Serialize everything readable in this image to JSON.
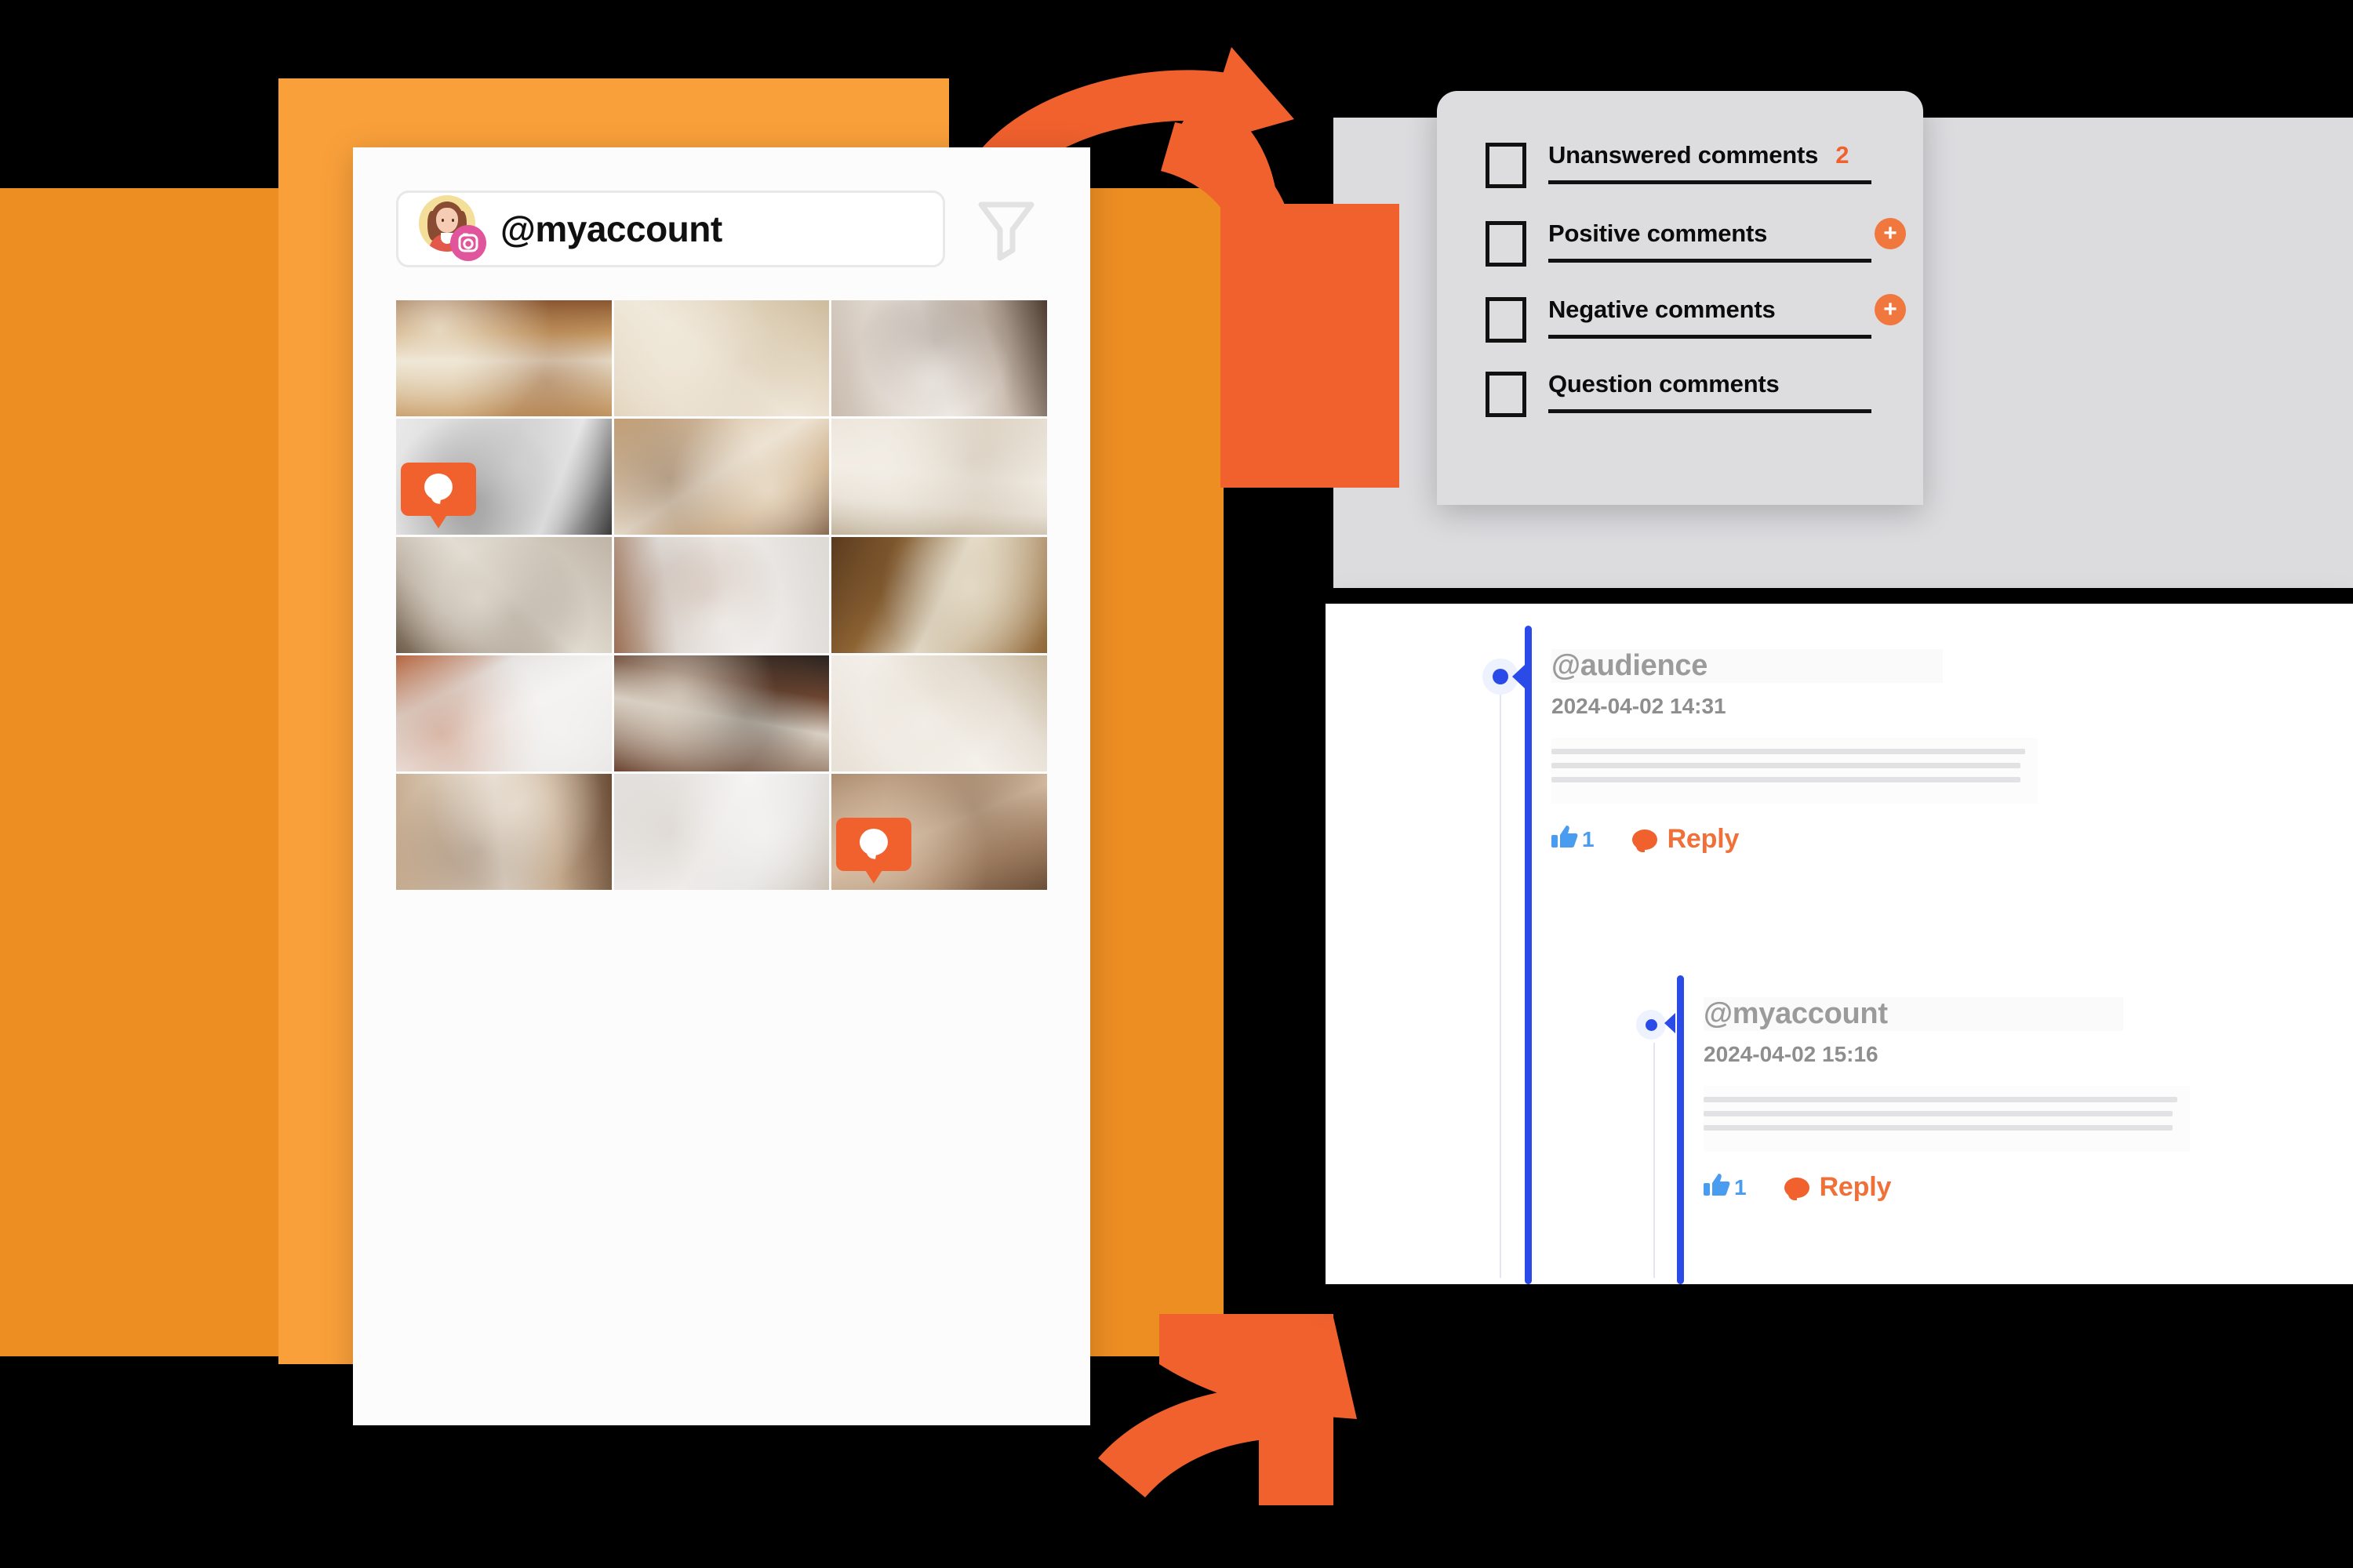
{
  "background": {
    "canvas_color": "#000000",
    "rect_front_color": "#F9A03A",
    "rect_back_color": "#ED8E23",
    "accent_orange": "#F0612E",
    "accent_blue": "#2B4BE8"
  },
  "arrows": [
    {
      "name": "arrow-top",
      "direction": "up-right",
      "color": "#F0612E"
    },
    {
      "name": "arrow-bottom",
      "direction": "up-right",
      "color": "#F0612E"
    }
  ],
  "instagram_card": {
    "account": {
      "handle": "@myaccount",
      "avatar_icon": "woman-avatar-icon",
      "platform_badge_icon": "instagram-icon"
    },
    "filter_button_icon": "filter-funnel-icon",
    "grid": {
      "columns": 3,
      "cells": [
        {
          "name": "knit-sweaters-flatlay",
          "c1": "#C79A63",
          "c2": "#EFE7D6",
          "c3": "#8A5630",
          "badge": false
        },
        {
          "name": "paper-card-dried-flowers",
          "c1": "#E3D6C0",
          "c2": "#F0E8DA",
          "c3": "#CDBB9C",
          "badge": false
        },
        {
          "name": "woman-on-sofa-with-laptop",
          "c1": "#C9BBAE",
          "c2": "#EDE8E2",
          "c3": "#4C3A2E",
          "badge": false
        },
        {
          "name": "laptop-on-white-desk",
          "c1": "#E9E9E9",
          "c2": "#D2D2D2",
          "c3": "#3A3A3A",
          "badge": true
        },
        {
          "name": "woman-typing-on-couch",
          "c1": "#C7A47A",
          "c2": "#EDE3D3",
          "c3": "#6B4A30",
          "badge": false
        },
        {
          "name": "desk-with-basket-and-mouse",
          "c1": "#E6DED2",
          "c2": "#F2EDE5",
          "c3": "#BDAE96",
          "badge": false
        },
        {
          "name": "living-room-with-laptop",
          "c1": "#BFB4A6",
          "c2": "#E2DCD2",
          "c3": "#6E5C49",
          "badge": false
        },
        {
          "name": "woman-in-white-slip-dress",
          "c1": "#DDD9D5",
          "c2": "#F2F0EE",
          "c3": "#9A6E52",
          "badge": false
        },
        {
          "name": "folded-knit-blanket",
          "c1": "#8F6534",
          "c2": "#E8E0CD",
          "c3": "#5A3A1E",
          "badge": false
        },
        {
          "name": "vase-with-dried-pampas",
          "c1": "#E4E2E0",
          "c2": "#F4F3F2",
          "c3": "#B5653F",
          "badge": false
        },
        {
          "name": "laptop-on-wooden-table",
          "c1": "#6B4430",
          "c2": "#D8CFC2",
          "c3": "#2A2420",
          "badge": false
        },
        {
          "name": "beige-desk-flatlay",
          "c1": "#E7E0D6",
          "c2": "#F4F0EA",
          "c3": "#C6B59A",
          "badge": false
        },
        {
          "name": "woman-on-armchair-with-laptop",
          "c1": "#C4A98C",
          "c2": "#EBE2D6",
          "c3": "#6A4C36",
          "badge": false
        },
        {
          "name": "woman-holding-phone",
          "c1": "#E3E1DF",
          "c2": "#F5F4F3",
          "c3": "#C9BEB2",
          "badge": false
        },
        {
          "name": "brown-draped-fabric",
          "c1": "#A8866A",
          "c2": "#D6BEA4",
          "c3": "#6B4E36",
          "badge": true
        }
      ]
    },
    "comment_badge_icon": "comment-bubble-badge-icon"
  },
  "filter_panel": {
    "rows": [
      {
        "label": "Unanswered comments",
        "count": "2",
        "has_add": false,
        "checked": false
      },
      {
        "label": "Positive comments",
        "count": "",
        "has_add": true,
        "checked": false
      },
      {
        "label": "Negative comments",
        "count": "",
        "has_add": true,
        "checked": false
      },
      {
        "label": "Question comments",
        "count": "",
        "has_add": false,
        "checked": false
      }
    ],
    "add_icon": "plus-icon",
    "checkbox_icon": "checkbox-empty-icon"
  },
  "comment_thread": {
    "comments": [
      {
        "handle": "@audience",
        "timestamp": "2024-04-02 14:31",
        "like_count": "1",
        "reply_label": "Reply",
        "like_icon": "thumbs-up-icon",
        "reply_icon": "comment-bubble-icon",
        "body_lines": 3
      },
      {
        "handle": "@myaccount",
        "timestamp": "2024-04-02 15:16",
        "like_count": "1",
        "reply_label": "Reply",
        "like_icon": "thumbs-up-icon",
        "reply_icon": "comment-bubble-icon",
        "body_lines": 3
      }
    ]
  }
}
